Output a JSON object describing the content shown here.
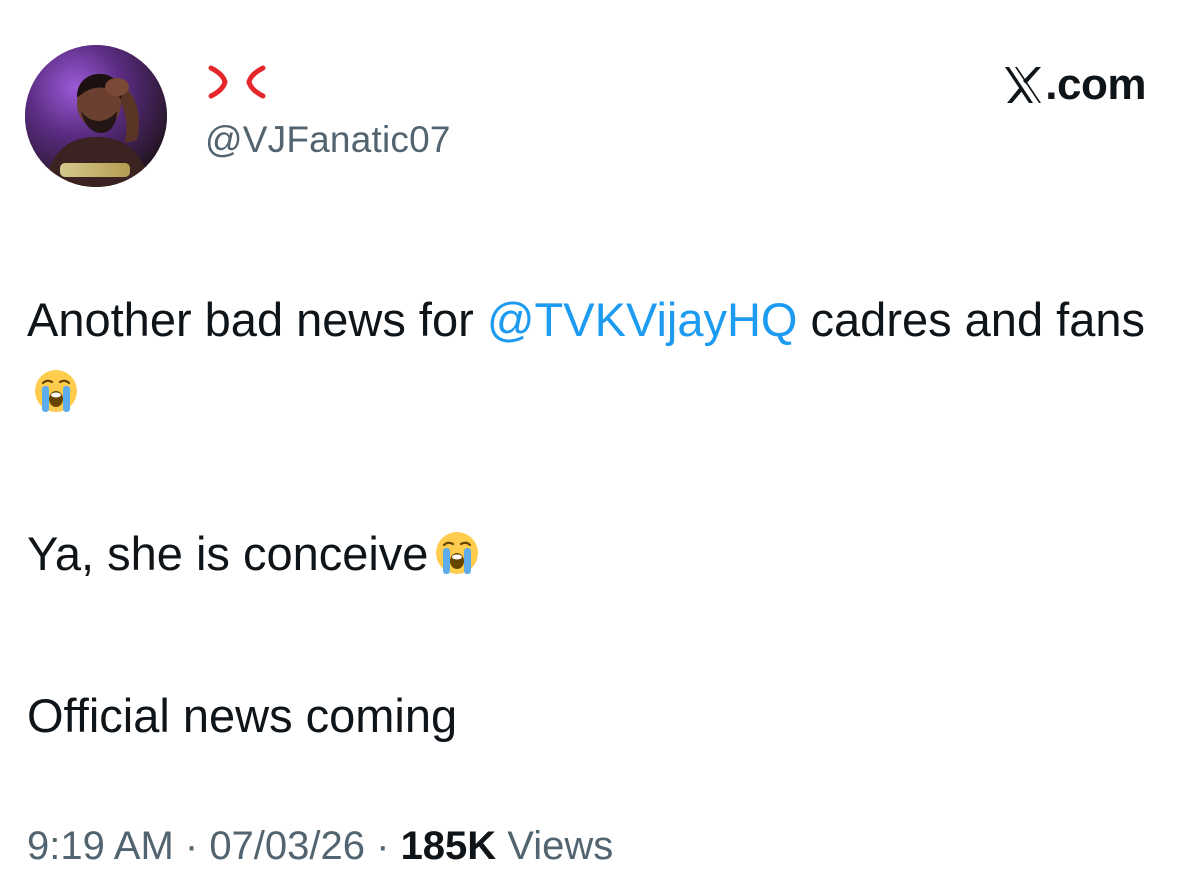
{
  "author": {
    "display_name_icon": "anger-symbol-icon",
    "handle": "@VJFanatic07",
    "avatar": "profile-photo"
  },
  "brand": {
    "label": ".com",
    "icon": "x-logo-icon"
  },
  "tweet": {
    "line1_prefix": "Another bad news for ",
    "mention": "@TVKVijayHQ",
    "line1_suffix": " cadres and fans",
    "line1_emoji": "loudly-crying-face-icon",
    "line2_text": "Ya, she is conceive",
    "line2_emoji": "loudly-crying-face-icon",
    "line3_text": "Official news coming"
  },
  "meta": {
    "time": "9:19 AM",
    "sep1": " · ",
    "date": "07/03/26",
    "sep2": " · ",
    "views_count": "185K",
    "views_label": " Views"
  },
  "colors": {
    "mention": "#1d9bf0",
    "secondary_text": "#536471",
    "primary_text": "#0f1419",
    "anger_symbol": "#e5262a"
  }
}
